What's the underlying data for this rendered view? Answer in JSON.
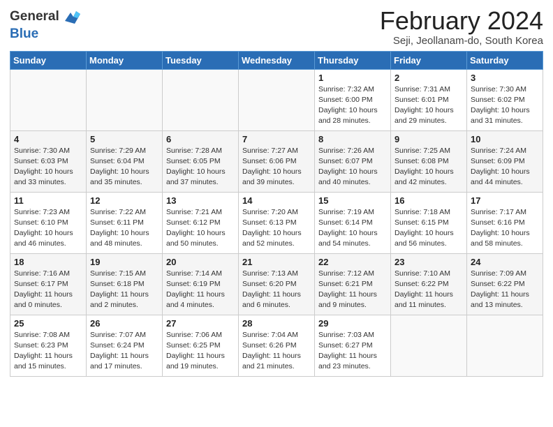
{
  "logo": {
    "line1": "General",
    "line2": "Blue"
  },
  "title": "February 2024",
  "subtitle": "Seji, Jeollanam-do, South Korea",
  "weekdays": [
    "Sunday",
    "Monday",
    "Tuesday",
    "Wednesday",
    "Thursday",
    "Friday",
    "Saturday"
  ],
  "weeks": [
    [
      {
        "day": "",
        "info": ""
      },
      {
        "day": "",
        "info": ""
      },
      {
        "day": "",
        "info": ""
      },
      {
        "day": "",
        "info": ""
      },
      {
        "day": "1",
        "info": "Sunrise: 7:32 AM\nSunset: 6:00 PM\nDaylight: 10 hours\nand 28 minutes."
      },
      {
        "day": "2",
        "info": "Sunrise: 7:31 AM\nSunset: 6:01 PM\nDaylight: 10 hours\nand 29 minutes."
      },
      {
        "day": "3",
        "info": "Sunrise: 7:30 AM\nSunset: 6:02 PM\nDaylight: 10 hours\nand 31 minutes."
      }
    ],
    [
      {
        "day": "4",
        "info": "Sunrise: 7:30 AM\nSunset: 6:03 PM\nDaylight: 10 hours\nand 33 minutes."
      },
      {
        "day": "5",
        "info": "Sunrise: 7:29 AM\nSunset: 6:04 PM\nDaylight: 10 hours\nand 35 minutes."
      },
      {
        "day": "6",
        "info": "Sunrise: 7:28 AM\nSunset: 6:05 PM\nDaylight: 10 hours\nand 37 minutes."
      },
      {
        "day": "7",
        "info": "Sunrise: 7:27 AM\nSunset: 6:06 PM\nDaylight: 10 hours\nand 39 minutes."
      },
      {
        "day": "8",
        "info": "Sunrise: 7:26 AM\nSunset: 6:07 PM\nDaylight: 10 hours\nand 40 minutes."
      },
      {
        "day": "9",
        "info": "Sunrise: 7:25 AM\nSunset: 6:08 PM\nDaylight: 10 hours\nand 42 minutes."
      },
      {
        "day": "10",
        "info": "Sunrise: 7:24 AM\nSunset: 6:09 PM\nDaylight: 10 hours\nand 44 minutes."
      }
    ],
    [
      {
        "day": "11",
        "info": "Sunrise: 7:23 AM\nSunset: 6:10 PM\nDaylight: 10 hours\nand 46 minutes."
      },
      {
        "day": "12",
        "info": "Sunrise: 7:22 AM\nSunset: 6:11 PM\nDaylight: 10 hours\nand 48 minutes."
      },
      {
        "day": "13",
        "info": "Sunrise: 7:21 AM\nSunset: 6:12 PM\nDaylight: 10 hours\nand 50 minutes."
      },
      {
        "day": "14",
        "info": "Sunrise: 7:20 AM\nSunset: 6:13 PM\nDaylight: 10 hours\nand 52 minutes."
      },
      {
        "day": "15",
        "info": "Sunrise: 7:19 AM\nSunset: 6:14 PM\nDaylight: 10 hours\nand 54 minutes."
      },
      {
        "day": "16",
        "info": "Sunrise: 7:18 AM\nSunset: 6:15 PM\nDaylight: 10 hours\nand 56 minutes."
      },
      {
        "day": "17",
        "info": "Sunrise: 7:17 AM\nSunset: 6:16 PM\nDaylight: 10 hours\nand 58 minutes."
      }
    ],
    [
      {
        "day": "18",
        "info": "Sunrise: 7:16 AM\nSunset: 6:17 PM\nDaylight: 11 hours\nand 0 minutes."
      },
      {
        "day": "19",
        "info": "Sunrise: 7:15 AM\nSunset: 6:18 PM\nDaylight: 11 hours\nand 2 minutes."
      },
      {
        "day": "20",
        "info": "Sunrise: 7:14 AM\nSunset: 6:19 PM\nDaylight: 11 hours\nand 4 minutes."
      },
      {
        "day": "21",
        "info": "Sunrise: 7:13 AM\nSunset: 6:20 PM\nDaylight: 11 hours\nand 6 minutes."
      },
      {
        "day": "22",
        "info": "Sunrise: 7:12 AM\nSunset: 6:21 PM\nDaylight: 11 hours\nand 9 minutes."
      },
      {
        "day": "23",
        "info": "Sunrise: 7:10 AM\nSunset: 6:22 PM\nDaylight: 11 hours\nand 11 minutes."
      },
      {
        "day": "24",
        "info": "Sunrise: 7:09 AM\nSunset: 6:22 PM\nDaylight: 11 hours\nand 13 minutes."
      }
    ],
    [
      {
        "day": "25",
        "info": "Sunrise: 7:08 AM\nSunset: 6:23 PM\nDaylight: 11 hours\nand 15 minutes."
      },
      {
        "day": "26",
        "info": "Sunrise: 7:07 AM\nSunset: 6:24 PM\nDaylight: 11 hours\nand 17 minutes."
      },
      {
        "day": "27",
        "info": "Sunrise: 7:06 AM\nSunset: 6:25 PM\nDaylight: 11 hours\nand 19 minutes."
      },
      {
        "day": "28",
        "info": "Sunrise: 7:04 AM\nSunset: 6:26 PM\nDaylight: 11 hours\nand 21 minutes."
      },
      {
        "day": "29",
        "info": "Sunrise: 7:03 AM\nSunset: 6:27 PM\nDaylight: 11 hours\nand 23 minutes."
      },
      {
        "day": "",
        "info": ""
      },
      {
        "day": "",
        "info": ""
      }
    ]
  ]
}
